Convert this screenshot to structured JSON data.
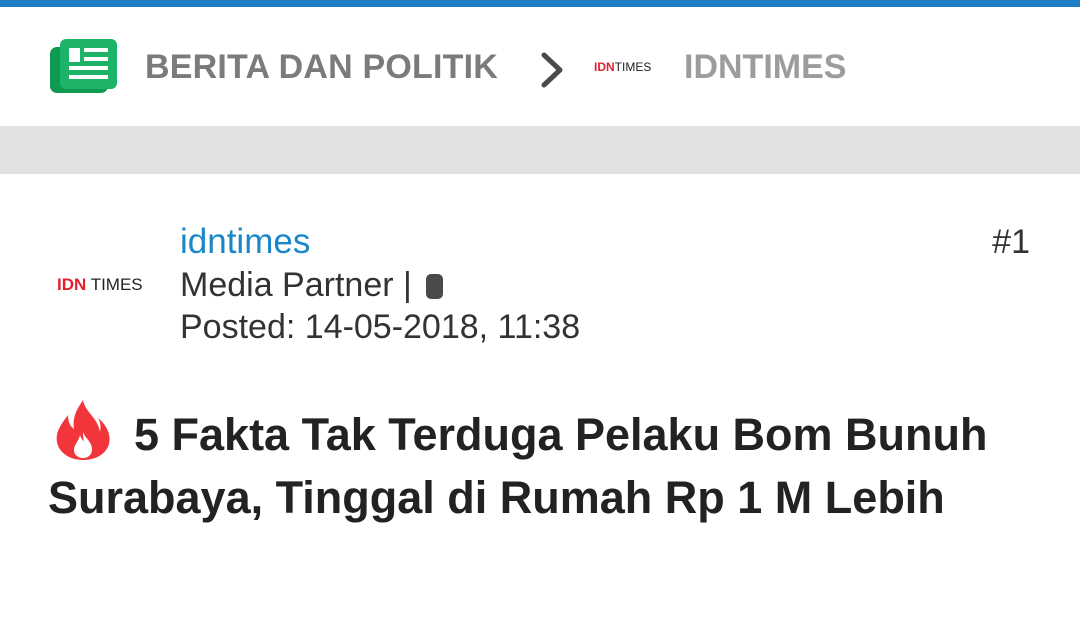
{
  "header": {
    "category_title": "BERITA DAN POLITIK",
    "source_logo": {
      "left": "IDN",
      "right": "TIMES"
    },
    "source_title": "IDNTIMES"
  },
  "post": {
    "avatar_logo": {
      "left": "IDN",
      "right": "TIMES"
    },
    "username": "idntimes",
    "role": "Media Partner |",
    "posted": "Posted: 14-05-2018, 11:38",
    "post_number": "#1",
    "title": "5 Fakta Tak Terduga Pelaku Bom Bunuh Surabaya, Tinggal di Rumah Rp 1 M Lebih"
  },
  "colors": {
    "topbar": "#1e7fc4",
    "category_text": "#7b7b7b",
    "source_text": "#9c9c9c",
    "username": "#1a87c9",
    "logo_red": "#e4202d",
    "band": "#e1e1e1",
    "fire": "#f2353a"
  },
  "icons": {
    "forum": "forum-newspaper-icon",
    "breadcrumb_separator": "chevron-right-icon",
    "hot": "fire-icon"
  }
}
